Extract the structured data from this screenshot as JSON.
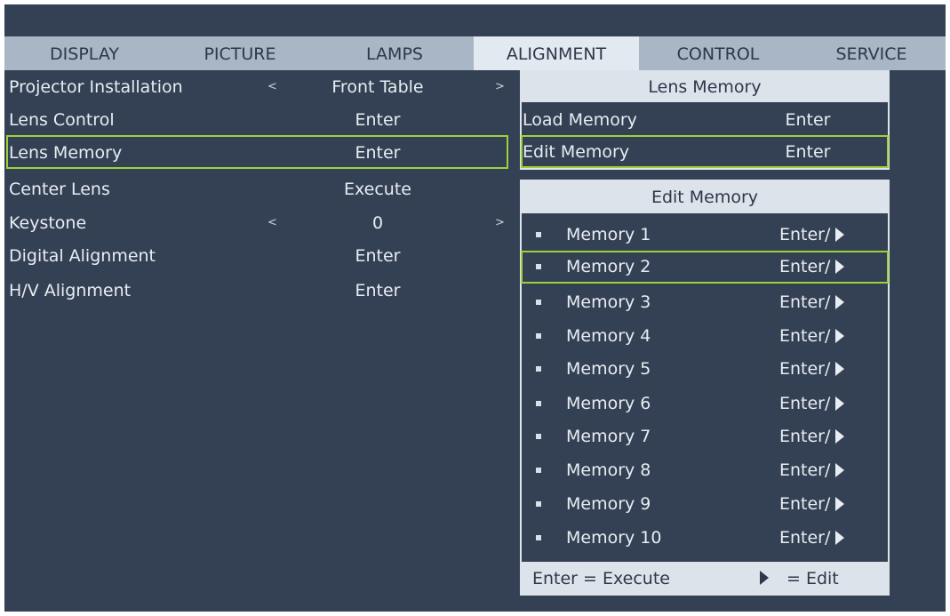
{
  "tabs": [
    {
      "label": "DISPLAY",
      "active": false
    },
    {
      "label": "PICTURE",
      "active": false
    },
    {
      "label": "LAMPS",
      "active": false
    },
    {
      "label": "ALIGNMENT",
      "active": true
    },
    {
      "label": "CONTROL",
      "active": false
    },
    {
      "label": "SERVICE",
      "active": false
    }
  ],
  "alignment_menu": {
    "items": [
      {
        "label": "Projector Installation",
        "value": "Front Table",
        "left_arrow": "<",
        "right_arrow": ">"
      },
      {
        "label": "Lens Control",
        "value": "Enter"
      },
      {
        "label": "Lens Memory",
        "value": "Enter",
        "selected": true
      },
      {
        "label": "Center Lens",
        "value": "Execute"
      },
      {
        "label": "Keystone",
        "value": "0",
        "left_arrow": "<",
        "right_arrow": ">"
      },
      {
        "label": "Digital Alignment",
        "value": "Enter"
      },
      {
        "label": "H/V Alignment",
        "value": "Enter"
      }
    ]
  },
  "lens_memory_panel": {
    "title": "Lens Memory",
    "items": [
      {
        "label": "Load Memory",
        "value": "Enter"
      },
      {
        "label": "Edit Memory",
        "value": "Enter",
        "selected": true
      }
    ]
  },
  "edit_memory_panel": {
    "title": "Edit Memory",
    "items": [
      {
        "label": "Memory 1",
        "value": "Enter/"
      },
      {
        "label": "Memory 2",
        "value": "Enter/",
        "selected": true
      },
      {
        "label": "Memory 3",
        "value": "Enter/"
      },
      {
        "label": "Memory 4",
        "value": "Enter/"
      },
      {
        "label": "Memory 5",
        "value": "Enter/"
      },
      {
        "label": "Memory 6",
        "value": "Enter/"
      },
      {
        "label": "Memory 7",
        "value": "Enter/"
      },
      {
        "label": "Memory 8",
        "value": "Enter/"
      },
      {
        "label": "Memory 9",
        "value": "Enter/"
      },
      {
        "label": "Memory 10",
        "value": "Enter/"
      }
    ],
    "footer": {
      "execute_hint": "Enter = Execute",
      "edit_hint": "= Edit"
    }
  },
  "colors": {
    "background": "#344154",
    "tab_bar": "#a9b6c6",
    "active_tab": "#e3e9f0",
    "highlight": "#9cd13b"
  },
  "icons": {
    "edit_arrow": "right-triangle-icon",
    "bullet": "square-bullet-icon"
  }
}
